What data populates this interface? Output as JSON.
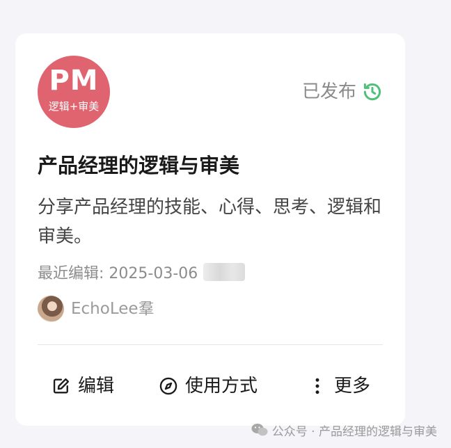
{
  "card": {
    "logo": {
      "main": "PM",
      "sub": "逻辑+审美",
      "color": "#e0646f"
    },
    "status": {
      "label": "已发布",
      "icon": "history-icon",
      "icon_color": "#4fbf7a"
    },
    "title": "产品经理的逻辑与审美",
    "description": "分享产品经理的技能、心得、思考、逻辑和审美。",
    "last_edited": "最近编辑: 2025-03-06",
    "author": {
      "name": "EchoLee羣",
      "avatar": "author-avatar"
    },
    "actions": [
      {
        "label": "编辑",
        "icon": "edit-icon"
      },
      {
        "label": "使用方式",
        "icon": "compass-icon"
      },
      {
        "label": "更多",
        "icon": "more-vertical-icon"
      }
    ]
  },
  "watermark": {
    "text": "公众号 · 产品经理的逻辑与审美",
    "icon": "wechat-icon"
  }
}
